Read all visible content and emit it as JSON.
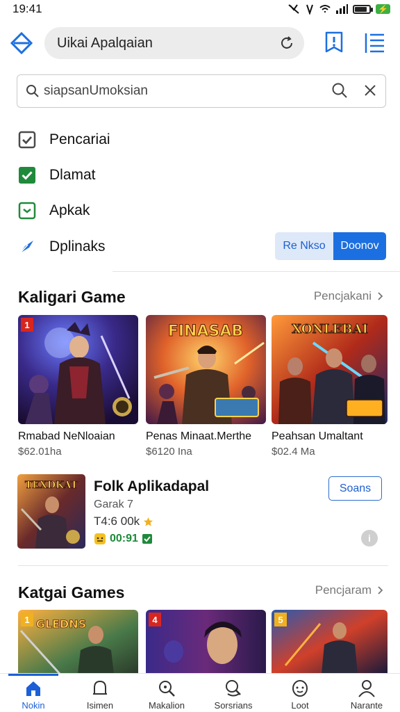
{
  "status_bar": {
    "time": "19:41",
    "battery_label": "⚡"
  },
  "top_bar": {
    "url_text": "Uikai Apalqaian"
  },
  "search": {
    "query": "siapsanUmoksian"
  },
  "filters": {
    "items": [
      {
        "label": "Pencariai",
        "state": "checked",
        "color": "#4a4a4a"
      },
      {
        "label": "Dlamat",
        "state": "checked",
        "color": "#1f8a3b"
      },
      {
        "label": "Apkak",
        "state": "partial",
        "color": "#1f8a3b"
      },
      {
        "label": "Dplinaks",
        "state": "icon",
        "color": "#1f6fe0"
      }
    ],
    "reset_label": "Re Nkso",
    "apply_label": "Doonov"
  },
  "section1": {
    "title": "Kaligari Game",
    "link": "Pencjakani",
    "cards": [
      {
        "rank": "1",
        "title": "Rmabad NeNloaian",
        "price": "$62.01ha",
        "art_title": ""
      },
      {
        "rank": "",
        "title": "Penas Minaat.Merthe",
        "price": "$6120 Ina",
        "art_title": "FINASAB"
      },
      {
        "rank": "",
        "title": "Peahsan Umaltant",
        "price": "$02.4 Ma",
        "art_title": "XONLEBAI"
      }
    ]
  },
  "featured": {
    "title": "Folk Aplikadapal",
    "subtitle": "Garak 7",
    "size": "T4:6 00k",
    "badge_text": "00:91",
    "open_label": "Soans",
    "info_label": "i",
    "art_title": "TEXDKAT"
  },
  "section2": {
    "title": "Katgai Games",
    "link": "Pencjaram",
    "cards": [
      {
        "rank": "1",
        "art_title": "GLEDNS"
      },
      {
        "rank": "4",
        "art_title": ""
      },
      {
        "rank": "5",
        "art_title": ""
      }
    ]
  },
  "bottom_nav": {
    "items": [
      {
        "label": "Nokin",
        "icon": "home-icon"
      },
      {
        "label": "Isimen",
        "icon": "bell-icon"
      },
      {
        "label": "Makalion",
        "icon": "search-zoom-icon"
      },
      {
        "label": "Sorsrians",
        "icon": "search-icon"
      },
      {
        "label": "Loot",
        "icon": "face-icon"
      },
      {
        "label": "Narante",
        "icon": "profile-icon"
      }
    ]
  },
  "colors": {
    "accent": "#1c6fe0",
    "green": "#1f8a3b",
    "rank_red": "#d8261f"
  }
}
